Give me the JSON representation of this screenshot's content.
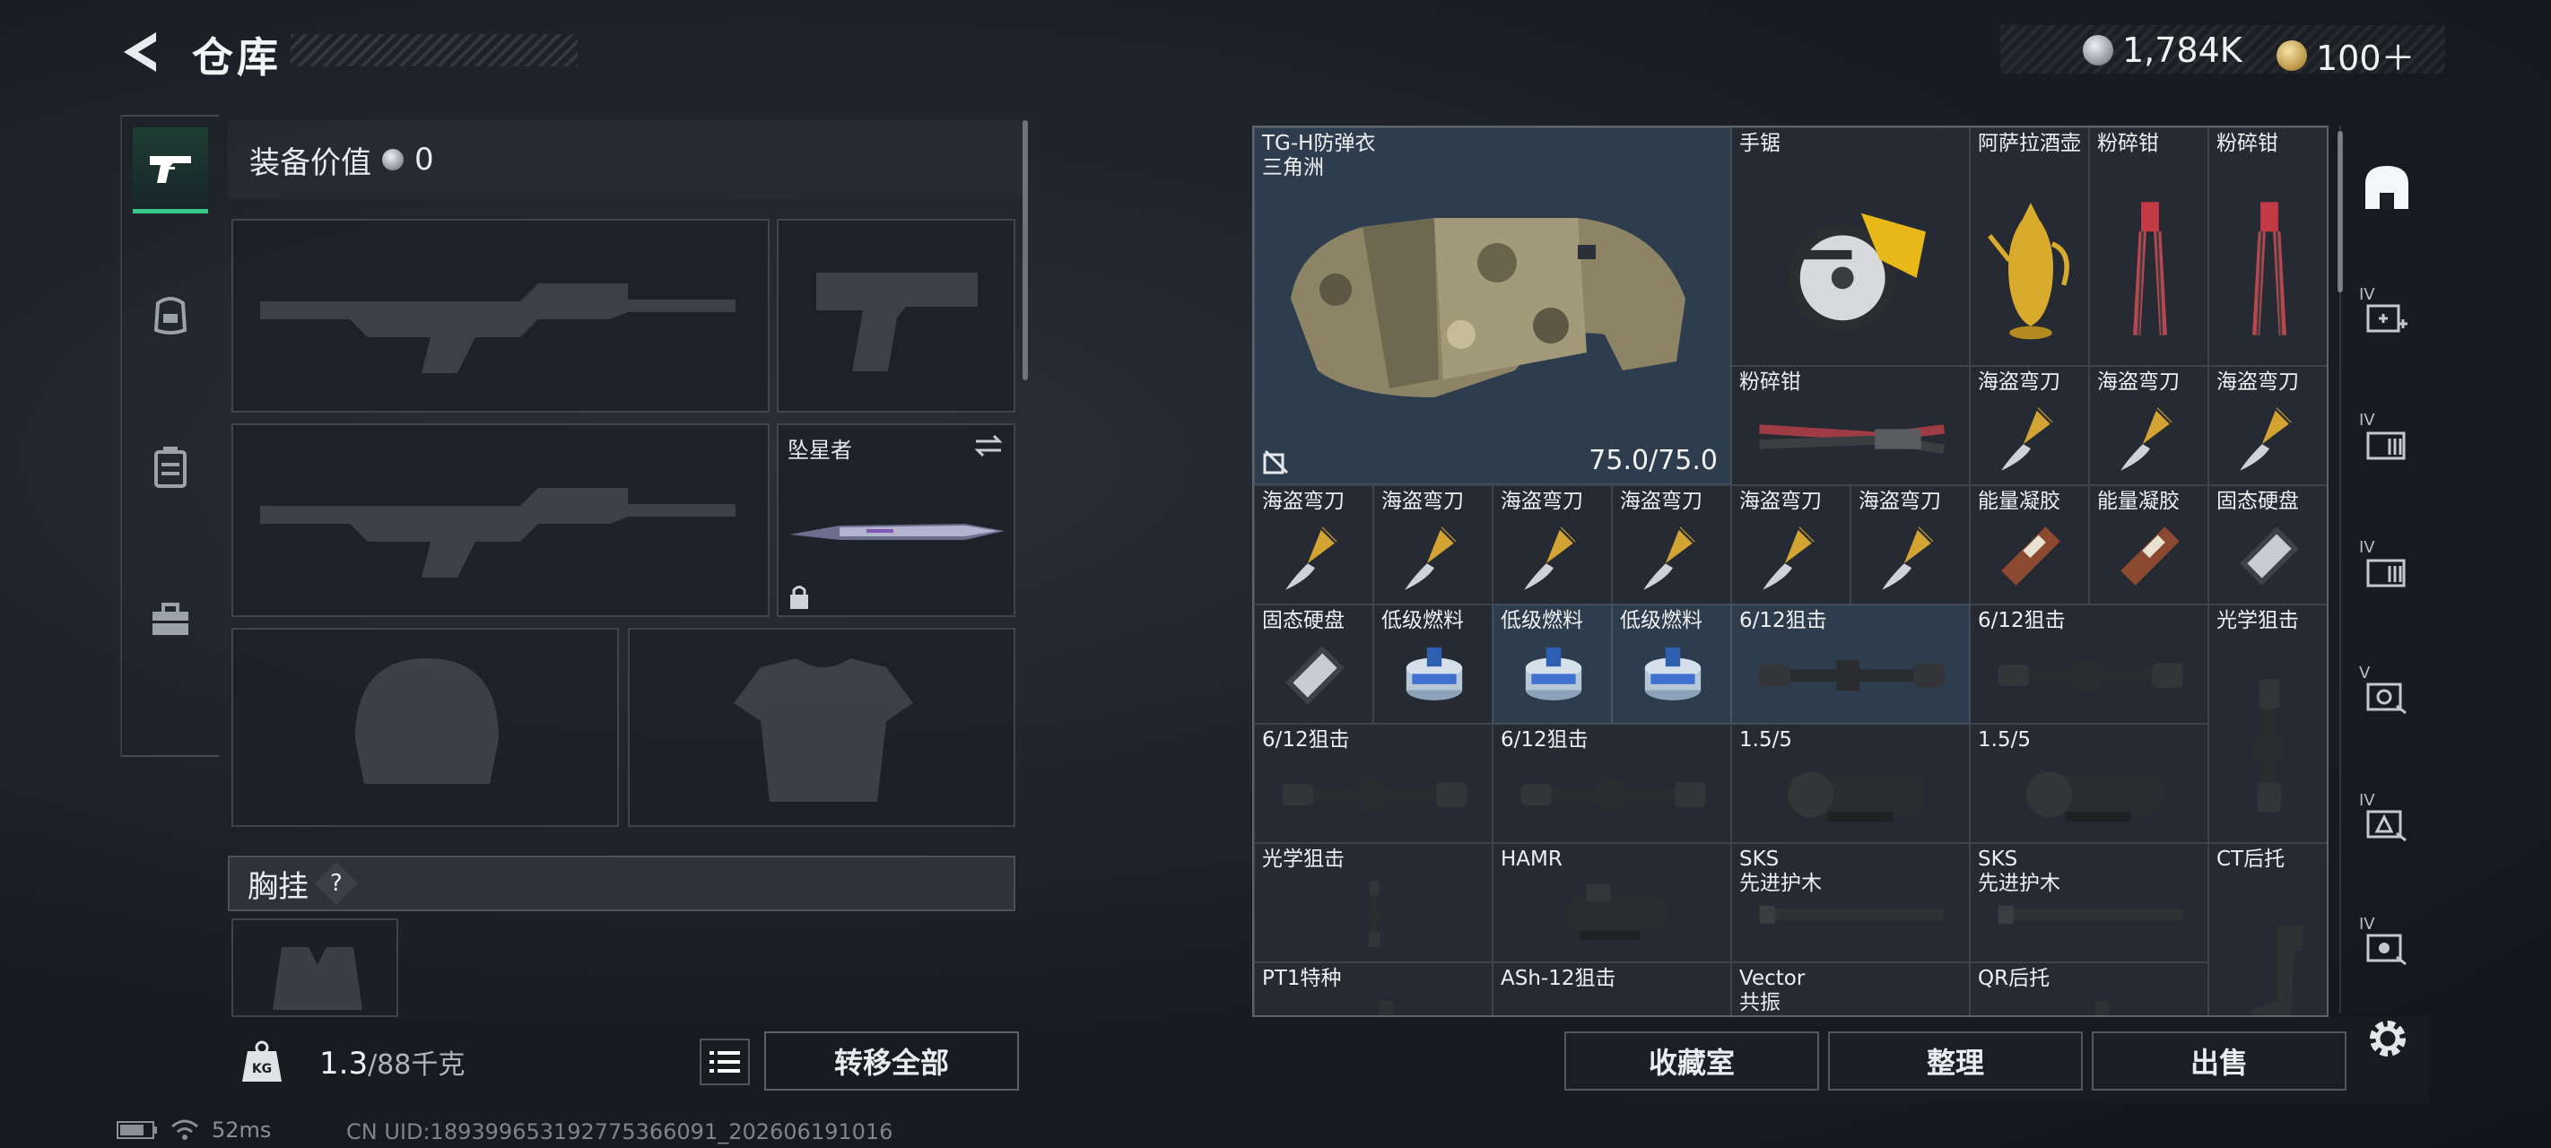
{
  "header": {
    "title": "仓库",
    "currency": [
      {
        "icon": "silver-coin-icon",
        "value": "1,784K"
      },
      {
        "icon": "gold-coin-icon",
        "value": "100＋"
      }
    ]
  },
  "left_rail": {
    "items": [
      {
        "icon": "pistol-icon",
        "active": true
      },
      {
        "icon": "helmet-icon",
        "active": false
      },
      {
        "icon": "backpack-icon",
        "active": false
      },
      {
        "icon": "toolbox-icon",
        "active": false
      }
    ]
  },
  "equipment": {
    "value_label": "装备价值",
    "value": "0",
    "melee_name": "坠星者",
    "chest_label": "胸挂",
    "chest_help": "?"
  },
  "bottom_left": {
    "weight_current": "1.3",
    "weight_max": "/88千克",
    "weight_icon_text": "KG",
    "transfer_all": "转移全部"
  },
  "status": {
    "ping": "52ms",
    "uid": "CN UID:18939965319277536609‌1_202606191016"
  },
  "stash": {
    "armor": {
      "name": "TG-H防弹衣",
      "sub": "三角洲",
      "durability": "75.0/75.0"
    },
    "items": [
      {
        "name": "手锯",
        "icon": "circular-saw-icon"
      },
      {
        "name": "阿萨拉酒壶",
        "icon": "golden-ewer-icon"
      },
      {
        "name": "粉碎钳",
        "icon": "crushing-pliers-icon"
      },
      {
        "name": "粉碎钳",
        "icon": "crushing-pliers-icon"
      },
      {
        "name": "粉碎钳",
        "icon": "bolt-cutter-icon"
      },
      {
        "name": "海盗弯刀",
        "icon": "pirate-knife-icon"
      },
      {
        "name": "海盗弯刀",
        "icon": "pirate-knife-icon"
      },
      {
        "name": "海盗弯刀",
        "icon": "pirate-knife-icon"
      },
      {
        "name": "海盗弯刀",
        "icon": "pirate-knife-icon"
      },
      {
        "name": "海盗弯刀",
        "icon": "pirate-knife-icon"
      },
      {
        "name": "海盗弯刀",
        "icon": "pirate-knife-icon"
      },
      {
        "name": "海盗弯刀",
        "icon": "pirate-knife-icon"
      },
      {
        "name": "海盗弯刀",
        "icon": "pirate-knife-icon"
      },
      {
        "name": "海盗弯刀",
        "icon": "pirate-knife-icon"
      },
      {
        "name": "能量凝胶",
        "icon": "energy-gel-icon"
      },
      {
        "name": "能量凝胶",
        "icon": "energy-gel-icon"
      },
      {
        "name": "固态硬盘",
        "icon": "ssd-icon"
      },
      {
        "name": "固态硬盘",
        "icon": "ssd-icon"
      },
      {
        "name": "低级燃料",
        "icon": "fuel-can-icon"
      },
      {
        "name": "低级燃料",
        "icon": "fuel-can-icon"
      },
      {
        "name": "低级燃料",
        "icon": "fuel-can-icon"
      },
      {
        "name": "6/12狙击",
        "icon": "sniper-scope-icon"
      },
      {
        "name": "6/12狙击",
        "icon": "sniper-scope-icon"
      },
      {
        "name": "光学狙击",
        "icon": "optical-scope-icon"
      },
      {
        "name": "6/12狙击",
        "icon": "sniper-scope-icon"
      },
      {
        "name": "6/12狙击",
        "icon": "sniper-scope-icon"
      },
      {
        "name": "1.5/5",
        "icon": "prism-scope-icon"
      },
      {
        "name": "1.5/5",
        "icon": "prism-scope-icon"
      },
      {
        "name": "光学狙击",
        "icon": "optical-scope-icon"
      },
      {
        "name": "HAMR",
        "icon": "hamr-scope-icon"
      },
      {
        "name": "SKS",
        "sub": "先进护木",
        "icon": "handguard-icon"
      },
      {
        "name": "SKS",
        "sub": "先进护木",
        "icon": "handguard-icon"
      },
      {
        "name": "CT后托",
        "icon": "stock-icon"
      },
      {
        "name": "PT1特种",
        "icon": "stock-icon"
      },
      {
        "name": "ASh-12狙击",
        "icon": "sniper-scope-icon"
      },
      {
        "name": "Vector",
        "sub": "共振",
        "icon": "handguard-icon"
      },
      {
        "name": "QR后托",
        "icon": "stock-icon"
      }
    ]
  },
  "right_rail": {
    "tags": [
      "IV",
      "IV",
      "IV",
      "V",
      "IV",
      "IV"
    ]
  },
  "actions": {
    "collection": "收藏室",
    "sort": "整理",
    "sell": "出售"
  }
}
